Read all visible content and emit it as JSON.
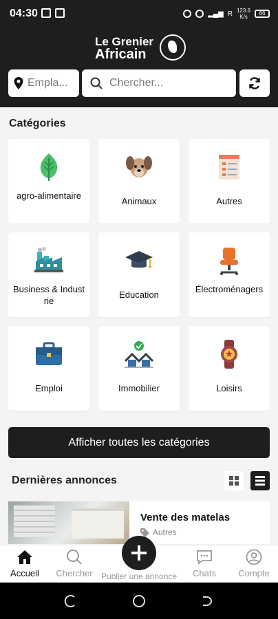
{
  "status_bar": {
    "time": "04:30",
    "net_speed": "123.6",
    "net_speed_unit": "K/s",
    "signal_label": "R",
    "battery": "66"
  },
  "header": {
    "logo_line1": "Le Grenier",
    "logo_line2": "Africain"
  },
  "search": {
    "location_placeholder": "Empla...",
    "query_placeholder": "Chercher..."
  },
  "categories": {
    "title": "Catégories",
    "items": [
      {
        "label": "agro-alimentaire",
        "icon": "leaf-icon"
      },
      {
        "label": "Animaux",
        "icon": "dog-icon"
      },
      {
        "label": "Autres",
        "icon": "checklist-icon"
      },
      {
        "label": "Business & Industrie",
        "icon": "factory-icon"
      },
      {
        "label": "Education",
        "icon": "graduation-cap-icon"
      },
      {
        "label": "Électroménagers",
        "icon": "office-chair-icon"
      },
      {
        "label": "Emploi",
        "icon": "briefcase-icon"
      },
      {
        "label": "Immobilier",
        "icon": "houses-icon"
      },
      {
        "label": "Loisirs",
        "icon": "watch-icon"
      }
    ],
    "show_all_label": "Afficher toutes les catégories"
  },
  "latest": {
    "title": "Dernières annonces",
    "ads": [
      {
        "title": "Vente des matelas",
        "category": "Autres"
      }
    ]
  },
  "bottom_nav": {
    "items": [
      {
        "label": "Accueil",
        "icon": "home-icon",
        "active": true
      },
      {
        "label": "Chercher",
        "icon": "search-icon",
        "active": false
      },
      {
        "label": "Publier une annonce",
        "icon": "plus-icon",
        "active": false
      },
      {
        "label": "Chats",
        "icon": "chat-icon",
        "active": false
      },
      {
        "label": "Compte",
        "icon": "user-icon",
        "active": false
      }
    ]
  },
  "colors": {
    "header_bg": "#1e1e1e",
    "accent": "#1e1e1e",
    "background": "#f4f4f4"
  }
}
